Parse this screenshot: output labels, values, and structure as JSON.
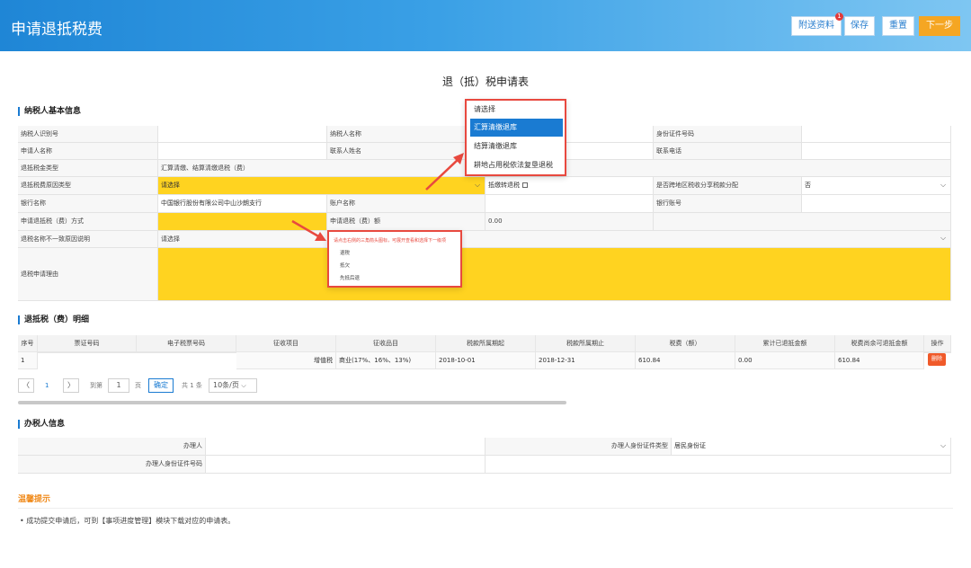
{
  "header": {
    "title": "申请退抵税费",
    "buttons": {
      "attachments": "附送资料",
      "attachments_badge": "1",
      "save": "保存",
      "reset": "重置",
      "next": "下一步"
    }
  },
  "form_title": "退（抵）税申请表",
  "taxpayer_section": {
    "title": "纳税人基本信息",
    "labels": {
      "taxpayer_id": "纳税人识别号",
      "taxpayer_name": "纳税人名称",
      "id_number": "身份证件号码",
      "applicant_name": "申请人名称",
      "contact_name": "联系人姓名",
      "contact_phone": "联系电话",
      "refund_type": "退抵税金类型",
      "refund_reason_type": "退抵税费原因类型",
      "offset_refund": "抵缴转退税",
      "cross_region": "是否跨地区税收分享税款分配",
      "bank_name": "银行名称",
      "account_name": "账户名称",
      "bank_account": "银行账号",
      "refund_method": "申请退抵税（费）方式",
      "refund_amount": "申请退税（费）额",
      "name_mismatch": "退税名称不一致原因说明",
      "refund_reason": "退税申请理由"
    },
    "values": {
      "refund_type": "汇算清缴、结算清缴退税（费）",
      "refund_reason_type": "请选择",
      "cross_region": "否",
      "bank_name": "中国银行股份有限公司中山沙朗支行",
      "refund_amount": "0.00",
      "name_mismatch": "请选择"
    }
  },
  "reason_dropdown": {
    "options": [
      "请选择",
      "汇算清缴退库",
      "结算清缴退库",
      "耕地占用税依法复垦退税"
    ],
    "selected_index": 1
  },
  "method_dropdown": {
    "hint": "请点击右侧的三角箭头图标，可展开查看和选择下一级项",
    "options": [
      "退税",
      "抵欠",
      "先抵后退"
    ]
  },
  "detail_section": {
    "title": "退抵税（费）明细",
    "headers": [
      "序号",
      "票证号码",
      "电子税票号码",
      "征收项目",
      "征收品目",
      "税款所属期起",
      "税款所属期止",
      "税费（额）",
      "累计已退抵金额",
      "税费尚余可退抵金额",
      "操作"
    ],
    "rows": [
      [
        "1",
        "",
        "",
        "增值税",
        "商业(17%、16%、13%)",
        "2018-10-01",
        "2018-12-31",
        "610.84",
        "0.00",
        "610.84",
        "删除"
      ]
    ]
  },
  "pagination": {
    "prev": "〈",
    "current": "1",
    "next": "〉",
    "goto_label": "到第",
    "goto_value": "1",
    "page_unit": "页",
    "confirm": "确定",
    "total": "共 1 条",
    "page_size": "10条/页"
  },
  "agent_section": {
    "title": "办税人信息",
    "labels": {
      "agent": "办理人",
      "agent_id_type": "办理人身份证件类型",
      "agent_id_number": "办理人身份证件号码"
    },
    "values": {
      "agent_id_type": "居民身份证"
    }
  },
  "tips": {
    "title": "温馨提示",
    "text": "成功提交申请后，可到【事项进度管理】模块下载对应的申请表。"
  },
  "colors": {
    "header_blue": "#1f86d6",
    "highlight_yellow": "#ffd320",
    "callout_red": "#e8493f",
    "next_orange": "#f5a623",
    "select_blue": "#1a7bd2"
  }
}
